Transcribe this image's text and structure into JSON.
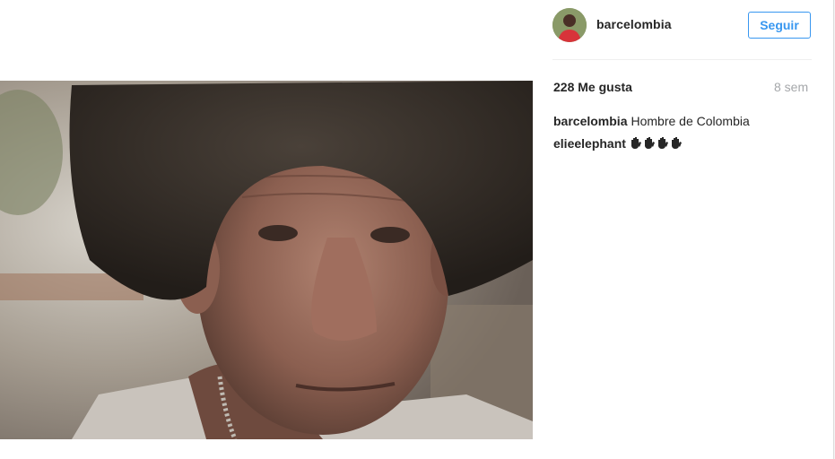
{
  "post": {
    "photo_icon": "portrait-photo",
    "author": {
      "username": "barcelombia",
      "avatar_icon": "avatar-photo",
      "follow_label": "Seguir"
    },
    "likes_label": "228 Me gusta",
    "time_label": "8 sem",
    "comments": [
      {
        "username": "barcelombia",
        "text": "Hombre de Colombia"
      },
      {
        "username": "elieelephant",
        "emoji_icon": "raised-hands-emoji",
        "emoji_count": 4
      }
    ]
  },
  "colors": {
    "accent": "#3897f0",
    "text": "#262626",
    "muted": "#a5a7aa",
    "divider": "#efefef"
  }
}
